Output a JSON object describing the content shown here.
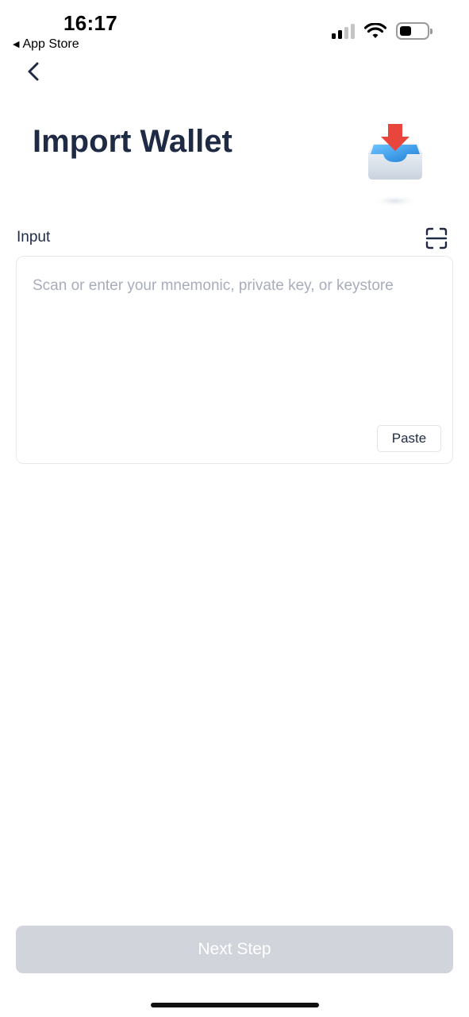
{
  "status_bar": {
    "time": "16:17",
    "back_app": "App Store",
    "signal_bars": 4,
    "signal_active": 2
  },
  "header": {
    "title": "Import Wallet"
  },
  "form": {
    "label": "Input",
    "value": "",
    "placeholder": "Scan or enter your mnemonic, private key, or keystore",
    "paste_label": "Paste"
  },
  "footer": {
    "next_label": "Next Step",
    "next_enabled": false
  },
  "colors": {
    "title": "#1f2a44",
    "placeholder": "#a8adbb",
    "button_disabled": "#d1d4db",
    "icon_red": "#e8453c",
    "icon_blue": "#2e95e6"
  },
  "icons": [
    "back-chevron-icon",
    "scan-icon",
    "import-tray-icon",
    "signal-icon",
    "wifi-icon",
    "battery-icon"
  ]
}
